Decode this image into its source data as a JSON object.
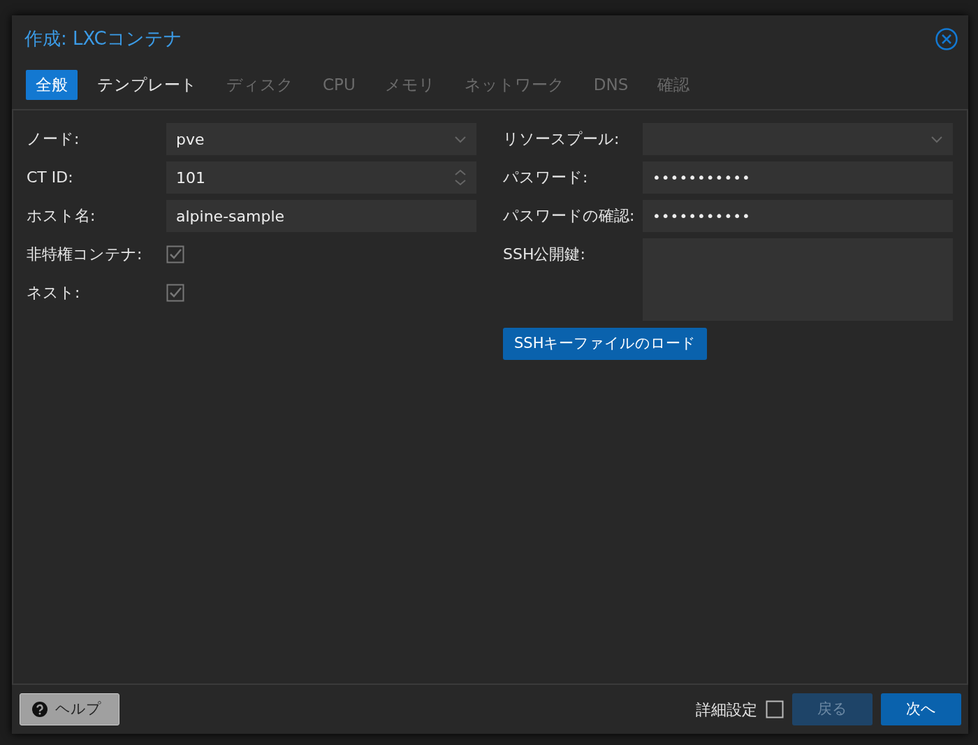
{
  "dialog": {
    "title": "作成: LXCコンテナ"
  },
  "tabs": [
    {
      "label": "全般",
      "selected": true,
      "disabled": false
    },
    {
      "label": "テンプレート",
      "selected": false,
      "disabled": false
    },
    {
      "label": "ディスク",
      "selected": false,
      "disabled": true
    },
    {
      "label": "CPU",
      "selected": false,
      "disabled": true
    },
    {
      "label": "メモリ",
      "selected": false,
      "disabled": true
    },
    {
      "label": "ネットワーク",
      "selected": false,
      "disabled": true
    },
    {
      "label": "DNS",
      "selected": false,
      "disabled": true
    },
    {
      "label": "確認",
      "selected": false,
      "disabled": true
    }
  ],
  "left_fields": [
    {
      "kind": "select",
      "label": "ノード:",
      "value": "pve"
    },
    {
      "kind": "number",
      "label": "CT ID:",
      "value": "101"
    },
    {
      "kind": "text",
      "label": "ホスト名:",
      "value": "alpine-sample"
    },
    {
      "kind": "checkbox",
      "label": "非特権コンテナ:",
      "checked": true
    },
    {
      "kind": "checkbox",
      "label": "ネスト:",
      "checked": true
    }
  ],
  "right_fields": [
    {
      "kind": "select",
      "label": "リソースプール:"
    },
    {
      "kind": "password",
      "label": "パスワード:",
      "value": "•••••••••••"
    },
    {
      "kind": "password",
      "label": "パスワードの確認:",
      "value": "•••••••••••"
    },
    {
      "kind": "textarea",
      "label": "SSH公開鍵:"
    }
  ],
  "load_key_button": "SSHキーファイルのロード",
  "footer": {
    "help_button": "ヘルプ",
    "advanced": {
      "label": "詳細設定",
      "checked": false
    },
    "back_button": {
      "label": "戻る",
      "disabled": true
    },
    "next_button": {
      "label": "次へ",
      "disabled": false
    }
  }
}
